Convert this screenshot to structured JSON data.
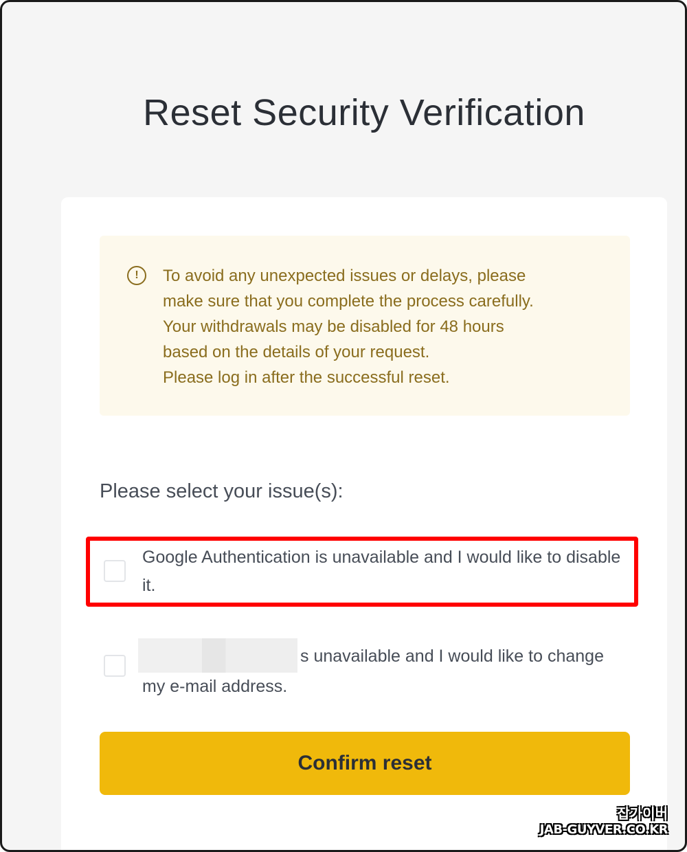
{
  "page": {
    "title": "Reset Security Verification"
  },
  "notice": {
    "icon": "info-circle-icon",
    "lines": [
      "To avoid any unexpected issues or delays, please",
      "make sure that you complete the process carefully.",
      "Your withdrawals may be disabled for 48 hours",
      "based on the details of your request.",
      "Please log in after the successful reset."
    ]
  },
  "issues": {
    "label": "Please select your issue(s):",
    "options": [
      {
        "text": "Google Authentication is unavailable and I would like to disable it.",
        "checked": false,
        "highlighted": true
      },
      {
        "text_prefix_redacted": true,
        "text": "s unavailable and I would like to change my e-mail address.",
        "checked": false,
        "highlighted": false
      }
    ]
  },
  "actions": {
    "confirm_label": "Confirm reset"
  },
  "colors": {
    "accent": "#f0b90b",
    "notice_bg": "#fdf9ec",
    "notice_text": "#8a6d1e",
    "highlight": "#ff0000"
  },
  "watermark": {
    "line1": "잡가이버",
    "line2": "JAB-GUYVER.CO.KR"
  }
}
